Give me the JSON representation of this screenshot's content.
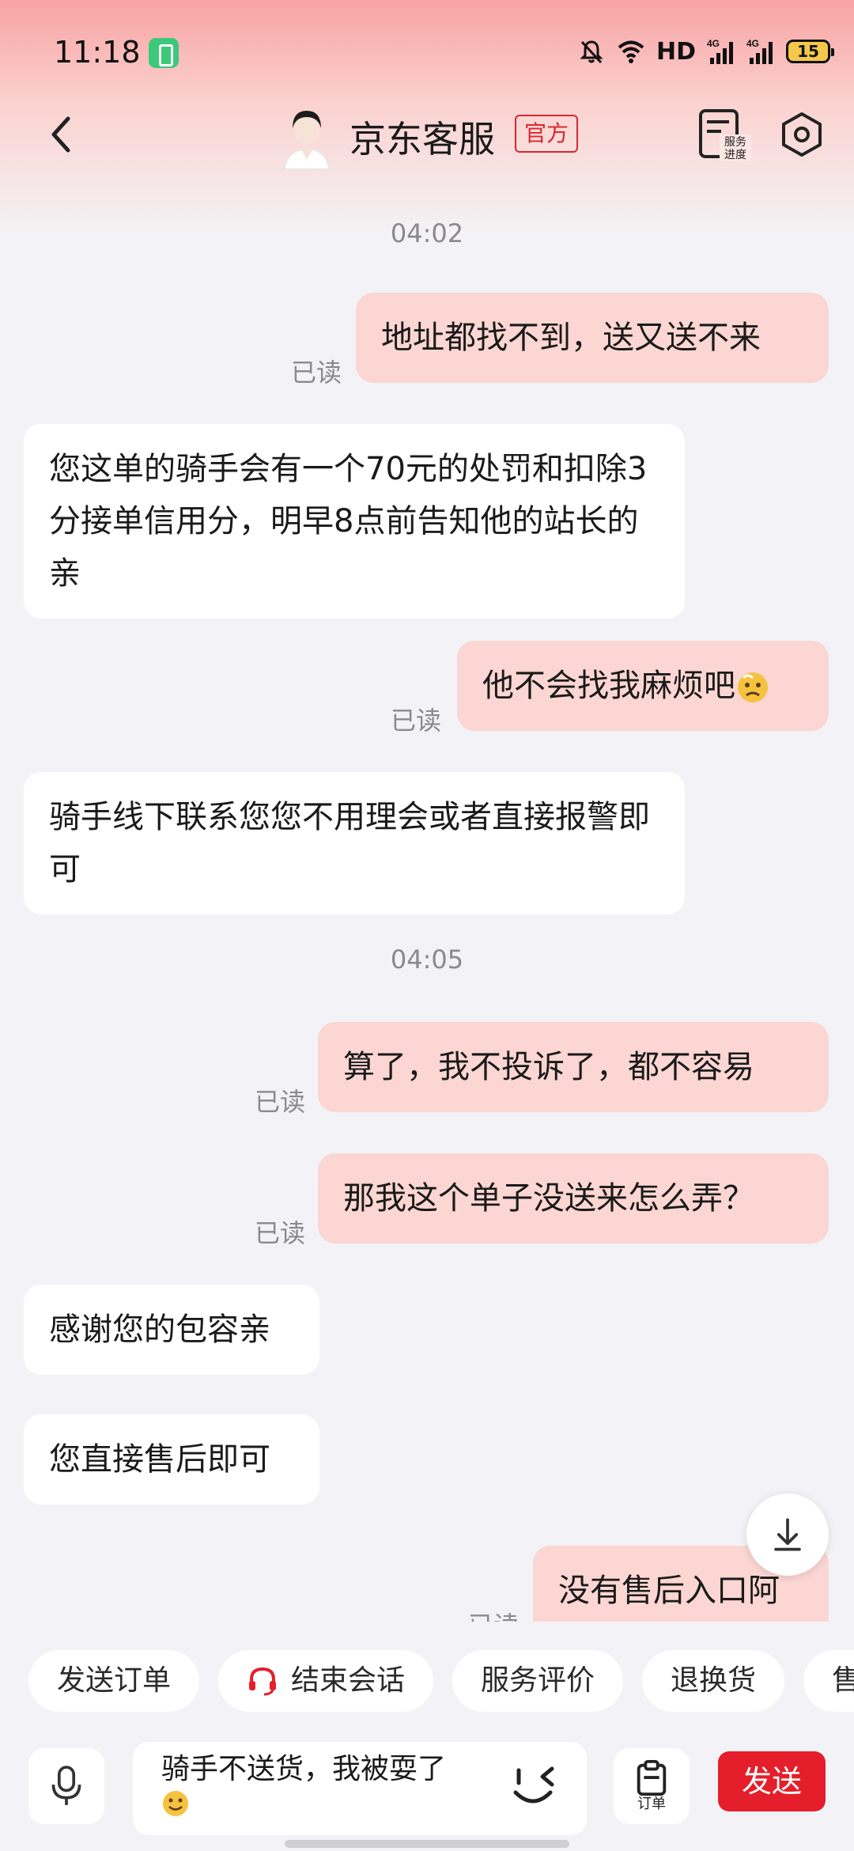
{
  "status_bar": {
    "time": "11:18",
    "network_label": "HD",
    "signal1_label": "4G",
    "signal2_label": "4G",
    "battery": "15"
  },
  "header": {
    "title": "京东客服",
    "badge": "官方",
    "progress_label_line1": "服务",
    "progress_label_line2": "进度"
  },
  "chat": {
    "messages": [
      {
        "type": "time",
        "text": "04:02"
      },
      {
        "type": "out",
        "text": "地址都找不到，送又送不来",
        "status": "已读"
      },
      {
        "type": "in",
        "text": "您这单的骑手会有一个70元的处罚和扣除3分接单信用分，明早8点前告知他的站长的亲"
      },
      {
        "type": "out",
        "text": "他不会找我麻烦吧",
        "status": "已读"
      },
      {
        "type": "in",
        "text": "骑手线下联系您您不用理会或者直接报警即可"
      },
      {
        "type": "time",
        "text": "04:05"
      },
      {
        "type": "out",
        "text": "算了，我不投诉了，都不容易",
        "status": "已读"
      },
      {
        "type": "out",
        "text": "那我这个单子没送来怎么弄？",
        "status": "已读"
      },
      {
        "type": "in",
        "text": "感谢您的包容亲"
      },
      {
        "type": "in",
        "text": "您直接售后即可"
      },
      {
        "type": "out",
        "text": "没有售后入口阿",
        "status": "已读"
      }
    ]
  },
  "quick_actions": [
    "发送订单",
    "结束会话",
    "服务评价",
    "退换货",
    "售"
  ],
  "input": {
    "value": "骑手不送货，我被耍了"
  },
  "order_button_label": "订单",
  "send_button_label": "发送",
  "colors": {
    "accent": "#e41f2b",
    "outgoing_bubble": "#fbd6d2",
    "incoming_bubble": "#ffffff",
    "background": "#f3f3f7"
  }
}
